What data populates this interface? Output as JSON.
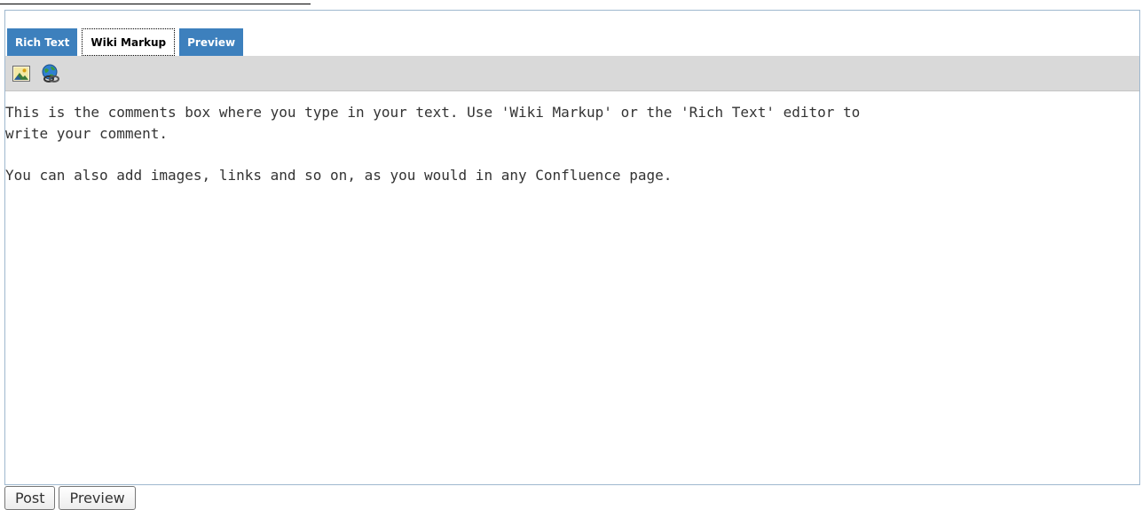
{
  "tabs": [
    {
      "label": "Rich Text",
      "active": false
    },
    {
      "label": "Wiki Markup",
      "active": true
    },
    {
      "label": "Preview",
      "active": false
    }
  ],
  "toolbar": {
    "icons": [
      "insert-image-icon",
      "insert-link-icon"
    ]
  },
  "editor": {
    "value": "This is the comments box where you type in your text. Use 'Wiki Markup' or the 'Rich Text' editor to\nwrite your comment.\n\nYou can also add images, links and so on, as you would in any Confluence page."
  },
  "actions": {
    "post_label": "Post",
    "preview_label": "Preview"
  },
  "colors": {
    "tab_inactive": "#3d80bd",
    "toolbar_bg": "#d9d9d9",
    "frame_border": "#9fb8cf"
  }
}
